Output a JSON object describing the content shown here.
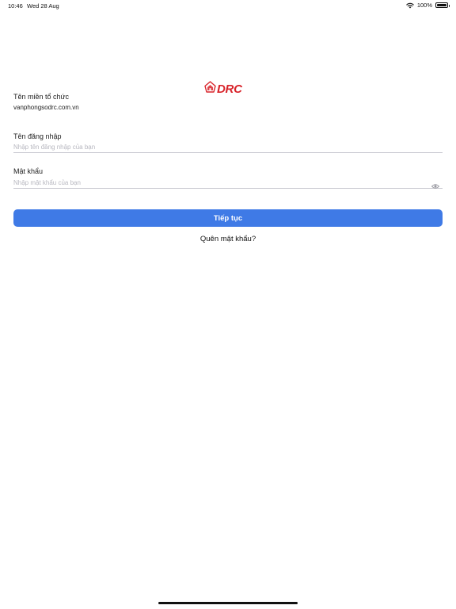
{
  "status_bar": {
    "time": "10:46",
    "date": "Wed 28 Aug",
    "battery": "100%"
  },
  "logo": {
    "text": "DRC",
    "color": "#d8232a"
  },
  "form": {
    "domain_label": "Tên miền tổ chức",
    "domain_value": "vanphongsodrc.com.vn",
    "username_label": "Tên đăng nhập",
    "username_placeholder": "Nhập tên đăng nhập của bạn",
    "password_label": "Mật khẩu",
    "password_placeholder": "Nhập mật khẩu của bạn",
    "password_toggle_icon": "eye-icon"
  },
  "actions": {
    "continue_label": "Tiếp tục",
    "continue_color": "#3f7ae6",
    "forgot_label": "Quên mật khẩu?"
  }
}
